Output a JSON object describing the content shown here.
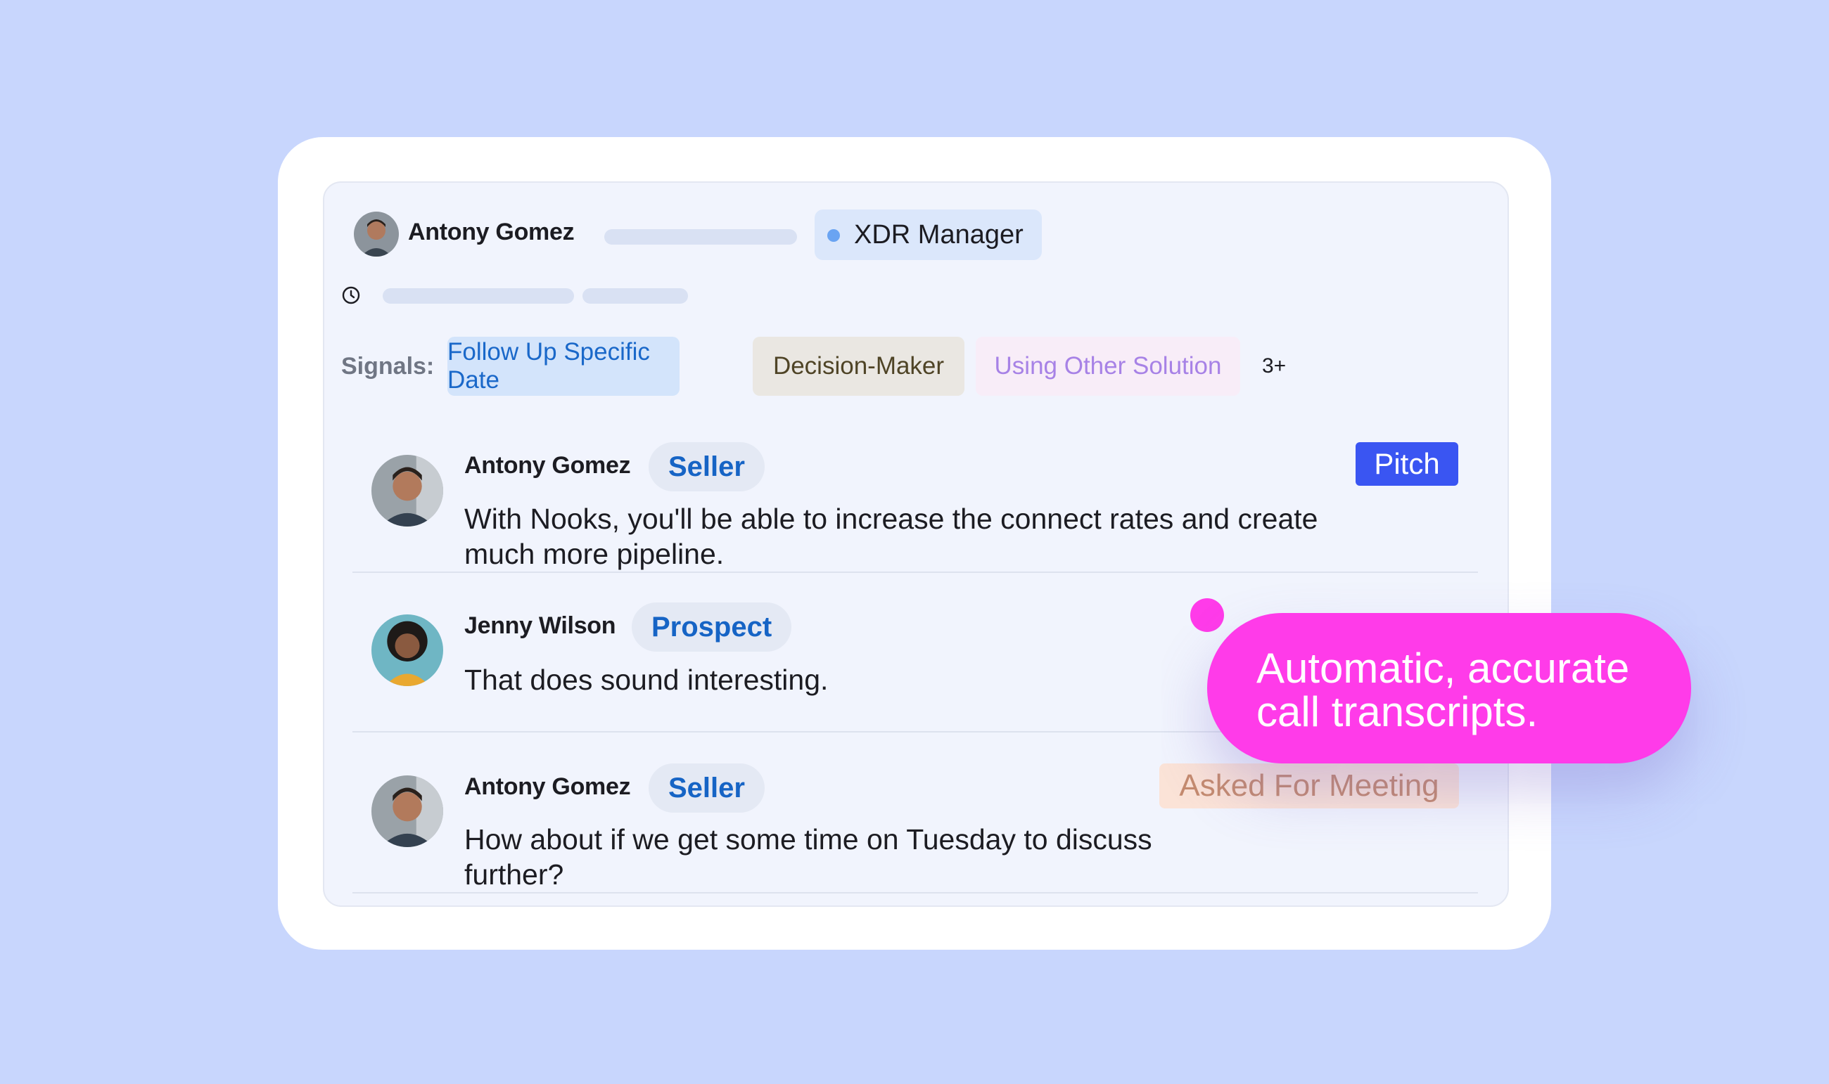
{
  "header": {
    "name": "Antony Gomez",
    "role": "XDR Manager"
  },
  "signals": {
    "label": "Signals:",
    "chips": [
      {
        "label": "Follow Up Specific Date",
        "bg": "#d3e4fb",
        "color": "#1a68c9"
      },
      {
        "label": "Decision-Maker",
        "bg": "#eae7e2",
        "color": "#4f4426"
      },
      {
        "label": "Using Other Solution",
        "bg": "#f8edf8",
        "color": "#a782e6"
      }
    ],
    "more": "3+"
  },
  "messages": [
    {
      "name": "Antony Gomez",
      "role": "Seller",
      "lines": [
        "With Nooks, you'll be able to increase the connect rates and create",
        "much more pipeline."
      ],
      "tag": "Pitch"
    },
    {
      "name": "Jenny Wilson",
      "role": "Prospect",
      "lines": [
        "That does sound interesting."
      ]
    },
    {
      "name": "Antony Gomez",
      "role": "Seller",
      "lines": [
        "How about if we get some time on Tuesday to discuss",
        "further?"
      ],
      "tag": "Asked For Meeting"
    }
  ],
  "callout": {
    "lines": [
      "Automatic, accurate",
      "call transcripts."
    ],
    "color": "#ff3be9"
  },
  "icons": {
    "clock": "clock-icon",
    "avatar": "avatar"
  }
}
